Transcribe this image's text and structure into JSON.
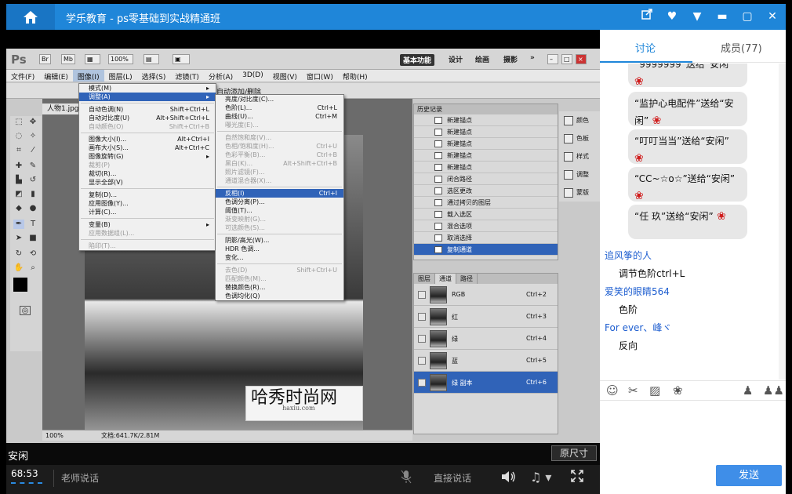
{
  "window": {
    "title": "学乐教育 - ps零基础到实战精通班",
    "icons": [
      "home-icon",
      "share-icon",
      "heart-icon",
      "dropdown-icon",
      "minimize-icon",
      "maximize-icon",
      "close-icon"
    ]
  },
  "ps": {
    "logo": "Ps",
    "zoom_box": "100%",
    "workspaces": {
      "essentials": "基本功能",
      "design": "设计",
      "painting": "绘画",
      "photography": "摄影",
      "more": "»"
    },
    "menubar": [
      "文件(F)",
      "编辑(E)",
      "图像(I)",
      "图层(L)",
      "选择(S)",
      "滤镜(T)",
      "分析(A)",
      "3D(D)",
      "视图(V)",
      "窗口(W)",
      "帮助(H)"
    ],
    "options_right": "自动添加/删除",
    "doc_tab": "人物1.jpg",
    "status_zoom": "100%",
    "status_doc": "文档:641.7K/2.81M",
    "watermark": {
      "main": "哈秀时尚网",
      "sub": "haxiu.com"
    },
    "image_menu": {
      "group1": [
        {
          "label": "模式(M)",
          "shortcut": "",
          "disabled": false,
          "arrow": true
        },
        {
          "label": "调整(A)",
          "shortcut": "",
          "disabled": false,
          "arrow": true,
          "highlight": true
        }
      ],
      "group2": [
        {
          "label": "自动色调(N)",
          "shortcut": "Shift+Ctrl+L",
          "disabled": false
        },
        {
          "label": "自动对比度(U)",
          "shortcut": "Alt+Shift+Ctrl+L",
          "disabled": false
        },
        {
          "label": "自动颜色(O)",
          "shortcut": "Shift+Ctrl+B",
          "disabled": true
        }
      ],
      "group3": [
        {
          "label": "图像大小(I)...",
          "shortcut": "Alt+Ctrl+I",
          "disabled": false
        },
        {
          "label": "画布大小(S)...",
          "shortcut": "Alt+Ctrl+C",
          "disabled": false
        },
        {
          "label": "图像旋转(G)",
          "shortcut": "",
          "disabled": false,
          "arrow": true
        },
        {
          "label": "裁剪(P)",
          "shortcut": "",
          "disabled": true
        },
        {
          "label": "裁切(R)...",
          "shortcut": "",
          "disabled": false
        },
        {
          "label": "显示全部(V)",
          "shortcut": "",
          "disabled": false
        }
      ],
      "group4": [
        {
          "label": "复制(D)...",
          "shortcut": "",
          "disabled": false
        },
        {
          "label": "应用图像(Y)...",
          "shortcut": "",
          "disabled": false
        },
        {
          "label": "计算(C)...",
          "shortcut": "",
          "disabled": false
        }
      ],
      "group5": [
        {
          "label": "变量(B)",
          "shortcut": "",
          "disabled": false,
          "arrow": true
        },
        {
          "label": "应用数据组(L)...",
          "shortcut": "",
          "disabled": true
        }
      ],
      "group6": [
        {
          "label": "陷印(T)...",
          "shortcut": "",
          "disabled": true
        }
      ]
    },
    "adjust_menu": {
      "group1": [
        {
          "label": "亮度/对比度(C)...",
          "shortcut": "",
          "disabled": false
        },
        {
          "label": "色阶(L)...",
          "shortcut": "Ctrl+L",
          "disabled": false
        },
        {
          "label": "曲线(U)...",
          "shortcut": "Ctrl+M",
          "disabled": false
        },
        {
          "label": "曝光度(E)...",
          "shortcut": "",
          "disabled": true
        }
      ],
      "group2": [
        {
          "label": "自然饱和度(V)...",
          "shortcut": "",
          "disabled": true
        },
        {
          "label": "色相/饱和度(H)...",
          "shortcut": "Ctrl+U",
          "disabled": true
        },
        {
          "label": "色彩平衡(B)...",
          "shortcut": "Ctrl+B",
          "disabled": true
        },
        {
          "label": "黑白(K)...",
          "shortcut": "Alt+Shift+Ctrl+B",
          "disabled": true
        },
        {
          "label": "照片滤镜(F)...",
          "shortcut": "",
          "disabled": true
        },
        {
          "label": "通道混合器(X)...",
          "shortcut": "",
          "disabled": true
        }
      ],
      "group3": [
        {
          "label": "反相(I)",
          "shortcut": "Ctrl+I",
          "disabled": false,
          "highlight": true
        },
        {
          "label": "色调分离(P)...",
          "shortcut": "",
          "disabled": false
        },
        {
          "label": "阈值(T)...",
          "shortcut": "",
          "disabled": false
        },
        {
          "label": "渐变映射(G)...",
          "shortcut": "",
          "disabled": true
        },
        {
          "label": "可选颜色(S)...",
          "shortcut": "",
          "disabled": true
        }
      ],
      "group4": [
        {
          "label": "阴影/高光(W)...",
          "shortcut": "",
          "disabled": false
        },
        {
          "label": "HDR 色调...",
          "shortcut": "",
          "disabled": false
        },
        {
          "label": "变化...",
          "shortcut": "",
          "disabled": false
        }
      ],
      "group5": [
        {
          "label": "去色(D)",
          "shortcut": "Shift+Ctrl+U",
          "disabled": true
        },
        {
          "label": "匹配颜色(M)...",
          "shortcut": "",
          "disabled": true
        },
        {
          "label": "替换颜色(R)...",
          "shortcut": "",
          "disabled": false
        },
        {
          "label": "色调均化(Q)",
          "shortcut": "",
          "disabled": false
        }
      ]
    },
    "history": {
      "title": "历史记录",
      "items": [
        "新建锚点",
        "新建锚点",
        "新建锚点",
        "新建锚点",
        "新建锚点",
        "闭合路径",
        "选区更改",
        "通过拷贝的图层",
        "载入选区",
        "混合选项",
        "取消选择",
        "复制通道"
      ],
      "selected_index": 11
    },
    "side_panel": [
      "颜色",
      "色板",
      "样式",
      "调整",
      "蒙版"
    ],
    "channels": {
      "tabs": [
        "图层",
        "通道",
        "路径"
      ],
      "active_tab": 1,
      "items": [
        {
          "name": "RGB",
          "shortcut": "Ctrl+2"
        },
        {
          "name": "红",
          "shortcut": "Ctrl+3"
        },
        {
          "name": "绿",
          "shortcut": "Ctrl+4"
        },
        {
          "name": "蓝",
          "shortcut": "Ctrl+5"
        },
        {
          "name": "绿 副本",
          "shortcut": "Ctrl+6",
          "selected": true
        }
      ]
    }
  },
  "caption": {
    "text": "安闲",
    "original_size": "原尺寸"
  },
  "controls": {
    "time": "68:53",
    "teacher": "老师说话",
    "direct": "直接说话"
  },
  "chat": {
    "tab_discuss": "讨论",
    "tab_members": "成员(77)",
    "bubbles": [
      {
        "text": "“9999999”送给“安闲”"
      },
      {
        "text": "“监护心电配件”送给“安闲”"
      },
      {
        "text": "“叮叮当当”送给“安闲”"
      },
      {
        "text": "“CC~☆o☆”送给“安闲”"
      },
      {
        "text": "“任 玖”送给“安闲”"
      }
    ],
    "messages": [
      {
        "user": "追风筝的人",
        "text": "调节色阶ctrl+L"
      },
      {
        "user": "爱笑的眼睛564",
        "text": "色阶"
      },
      {
        "user": "For ever、峰ヾ",
        "text": "反向"
      }
    ],
    "send": "发送",
    "colors": {
      "accent": "#1f86d9",
      "send": "#3f8ee8",
      "username": "#1f5fd0"
    }
  }
}
